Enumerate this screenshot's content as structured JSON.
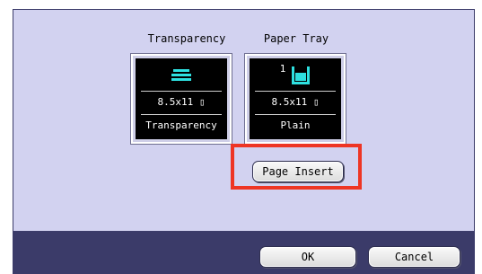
{
  "screen": {
    "trays": [
      {
        "caption": "Transparency",
        "icon": "paper-stack-icon",
        "size": "8.5x11 ▯",
        "type": "Transparency"
      },
      {
        "caption": "Paper Tray",
        "tray_number": "1",
        "icon": "paper-tray-icon",
        "size": "8.5x11 ▯",
        "type": "Plain"
      }
    ],
    "page_insert_label": "Page Insert"
  },
  "footer": {
    "ok_label": "OK",
    "cancel_label": "Cancel"
  },
  "colors": {
    "panel": "#d2d2f0",
    "bottom_bar": "#3b3b69",
    "highlight": "#ee3524",
    "icon": "#2ee0e0"
  }
}
